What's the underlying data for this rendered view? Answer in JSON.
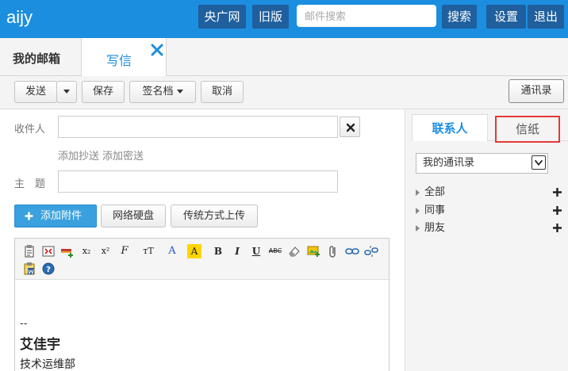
{
  "header": {
    "brand": "aijy",
    "cctv_label": "央广网",
    "old_version_label": "旧版",
    "search_placeholder": "邮件搜索",
    "search_label": "搜索",
    "settings_label": "设置",
    "logout_label": "退出"
  },
  "tabs": {
    "mailbox_label": "我的邮箱",
    "compose_label": "写信"
  },
  "toolbar": {
    "send_label": "发送",
    "save_label": "保存",
    "signature_label": "签名档",
    "cancel_label": "取消",
    "address_book_label": "通讯录"
  },
  "form": {
    "recipient_label": "收件人",
    "recipient_value": "",
    "add_cc_label": "添加抄送",
    "add_bcc_label": "添加密送",
    "subject_label": "主　题",
    "subject_value": "",
    "attach_label": "添加附件",
    "netdisk_label": "网络硬盘",
    "legacy_upload_label": "传统方式上传"
  },
  "editor_toolbar": {
    "subscript": "x₂",
    "superscript": "x²",
    "font_family": "F",
    "font_size": "тT",
    "font_color": "A",
    "highlight": "A",
    "bold": "B",
    "italic": "I",
    "underline": "U",
    "strikethrough": "ABC"
  },
  "signature": {
    "separator": "--",
    "name": "艾佳宇",
    "department": "技术运维部"
  },
  "contacts_panel": {
    "contacts_tab": "联系人",
    "stationery_tab": "信纸",
    "book_select": "我的通讯录",
    "groups": [
      {
        "label": "全部"
      },
      {
        "label": "同事"
      },
      {
        "label": "朋友"
      }
    ]
  },
  "colors": {
    "header_bg": "#1b8ee0",
    "header_button_bg": "#1f5f9e",
    "accent_blue": "#1b8ee0",
    "attach_button_bg": "#3ba0de",
    "stationery_highlight": "#e53935"
  }
}
